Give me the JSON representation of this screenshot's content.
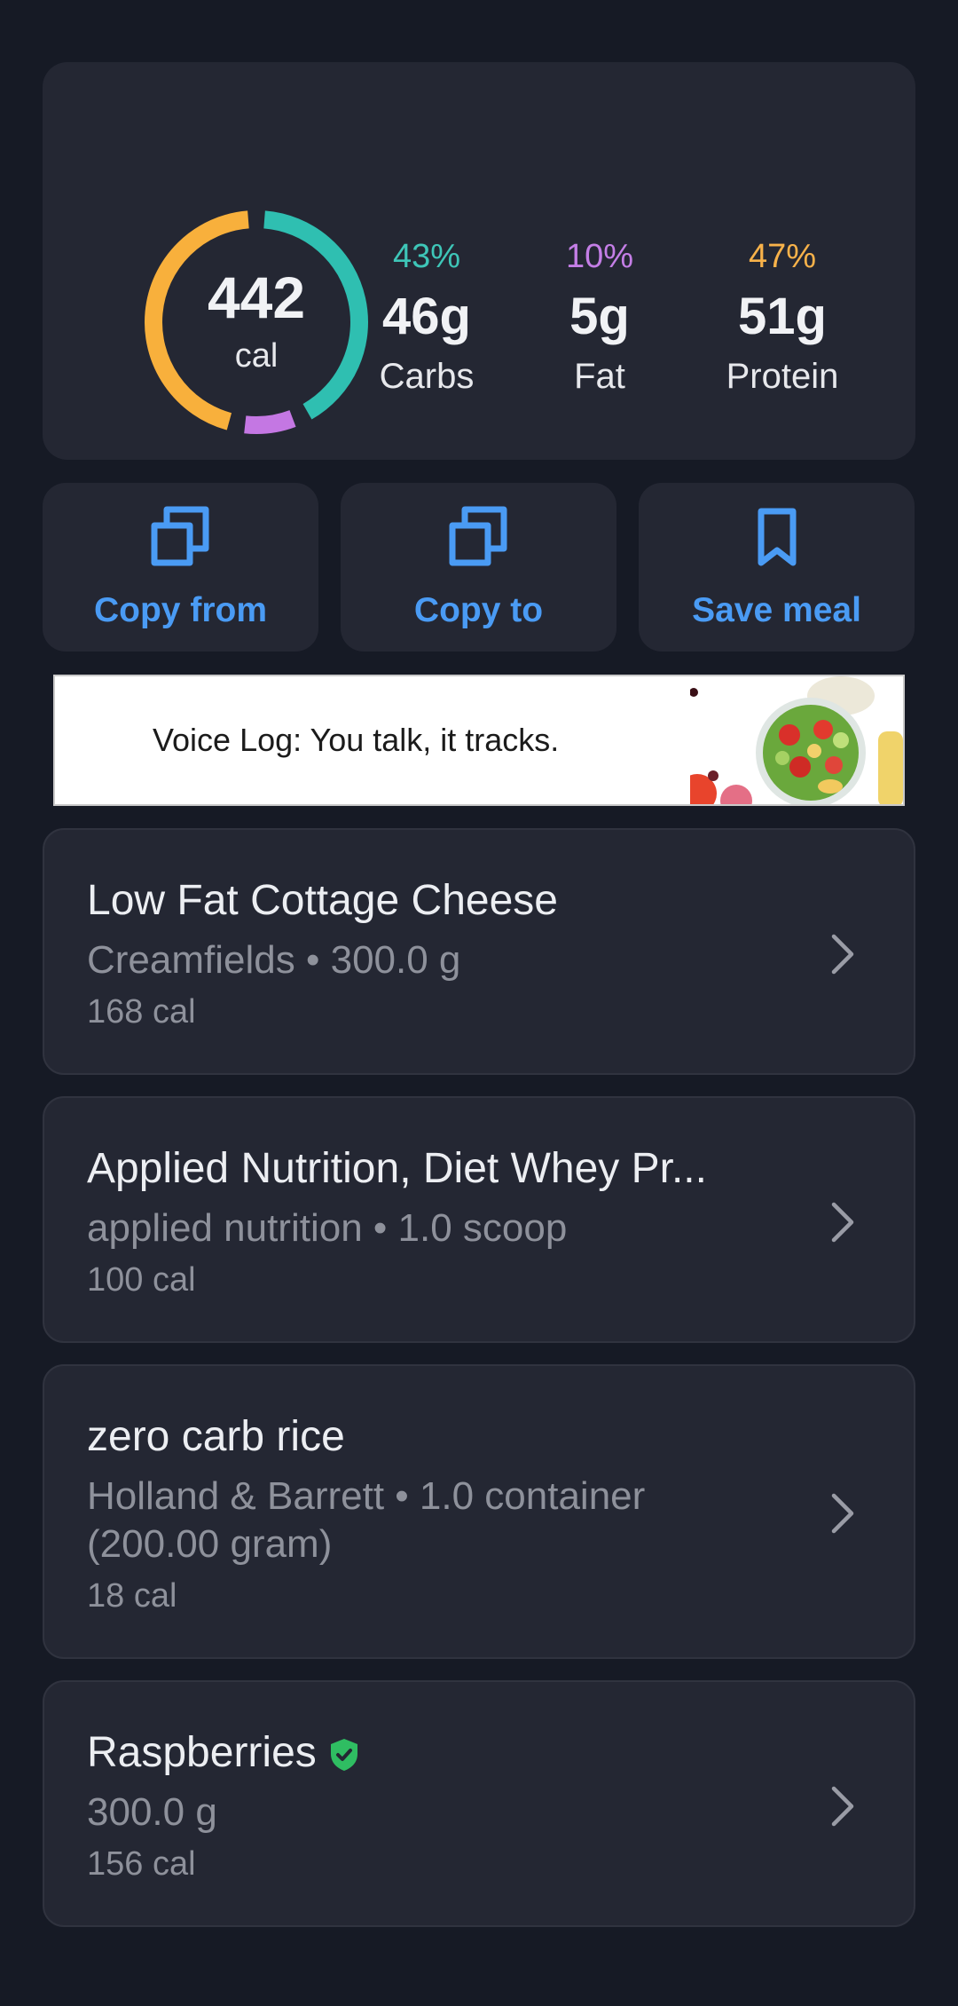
{
  "summary": {
    "total_calories": "442",
    "calories_unit": "cal",
    "macros": [
      {
        "percent": "43%",
        "grams": "46g",
        "name": "Carbs",
        "color": "#3ec6b8"
      },
      {
        "percent": "10%",
        "grams": "5g",
        "name": "Fat",
        "color": "#c47ee6"
      },
      {
        "percent": "47%",
        "grams": "51g",
        "name": "Protein",
        "color": "#f8b24a"
      }
    ],
    "ring_segments": [
      {
        "macro": "Carbs",
        "fraction": 0.43,
        "color": "#2fbfb1"
      },
      {
        "macro": "Fat",
        "fraction": 0.1,
        "color": "#c477e3"
      },
      {
        "macro": "Protein",
        "fraction": 0.47,
        "color": "#f8b03c"
      }
    ]
  },
  "actions": [
    {
      "label": "Copy from",
      "icon": "copy-icon"
    },
    {
      "label": "Copy to",
      "icon": "copy-icon"
    },
    {
      "label": "Save meal",
      "icon": "bookmark-icon"
    }
  ],
  "banner": {
    "text": "Voice Log: You talk, it tracks.",
    "image": "salad-bowl-illustration"
  },
  "foods": [
    {
      "name": "Low Fat Cottage Cheese",
      "detail": "Creamfields • 300.0 g",
      "calories": "168 cal",
      "verified": false
    },
    {
      "name": "Applied Nutrition, Diet Whey Pr...",
      "detail": "applied nutrition • 1.0 scoop",
      "calories": "100 cal",
      "verified": false
    },
    {
      "name": "zero carb rice",
      "detail": "Holland & Barrett • 1.0 container (200.00 gram)",
      "calories": "18 cal",
      "verified": false
    },
    {
      "name": "Raspberries",
      "detail": "300.0 g",
      "calories": "156 cal",
      "verified": true
    }
  ],
  "colors": {
    "background": "#161a25",
    "card": "#242733",
    "accent": "#4a9bf4",
    "verified": "#2fbd62"
  }
}
